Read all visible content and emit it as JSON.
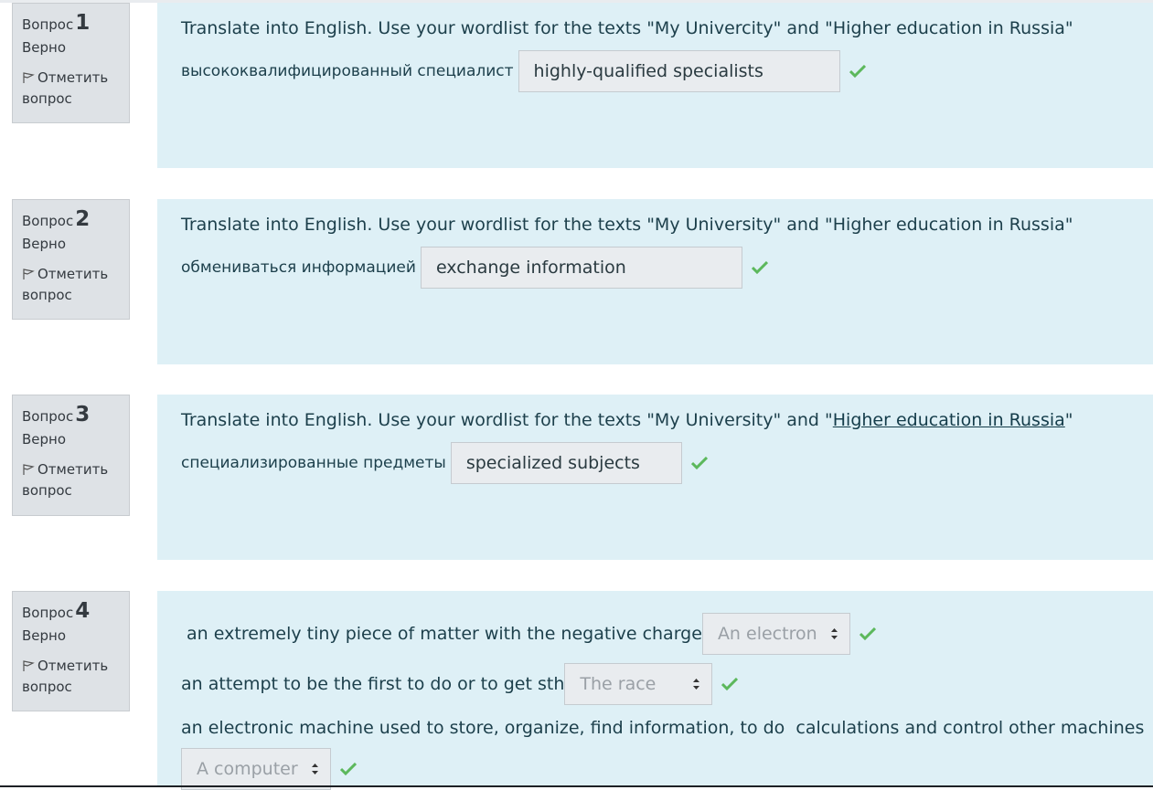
{
  "question_label": "Вопрос",
  "state_label": "Верно",
  "flag_label": "Отметить вопрос",
  "questions": [
    {
      "number": "1",
      "text": "Translate into English. Use your wordlist for the texts \"My Univercity\" and \"Higher education in Russia\"",
      "prompt": "высококвалифицированный специалист",
      "answer": "highly-qualified specialists"
    },
    {
      "number": "2",
      "text": "Translate into English. Use your wordlist for the texts \"My University\" and \"Higher education in Russia\"",
      "prompt": "обмениваться информацией",
      "answer": "exchange information"
    },
    {
      "number": "3",
      "text_before_link": "Translate into English. Use your wordlist for the texts \"My University\" and \"",
      "link_text": "Higher education in Russia",
      "text_after_link": "\"",
      "prompt": "специализированные предметы",
      "answer": "specialized subjects"
    },
    {
      "number": "4",
      "items": [
        {
          "prompt": " an extremely tiny piece of matter with the negative charge",
          "selected": "An electron"
        },
        {
          "prompt": "an attempt to be the first to do or to get sth",
          "selected": "The race"
        },
        {
          "prompt": "an electronic machine used to store, organize, find information, to do  calculations and control other machines",
          "selected": "A computer"
        }
      ]
    }
  ],
  "colors": {
    "content_bg": "#def0f6",
    "info_bg": "#dee2e6",
    "correct_check": "#5cb85c"
  },
  "icons": {
    "flag": "flag-icon",
    "check": "check-icon",
    "select_arrows": "select-arrows-icon"
  }
}
